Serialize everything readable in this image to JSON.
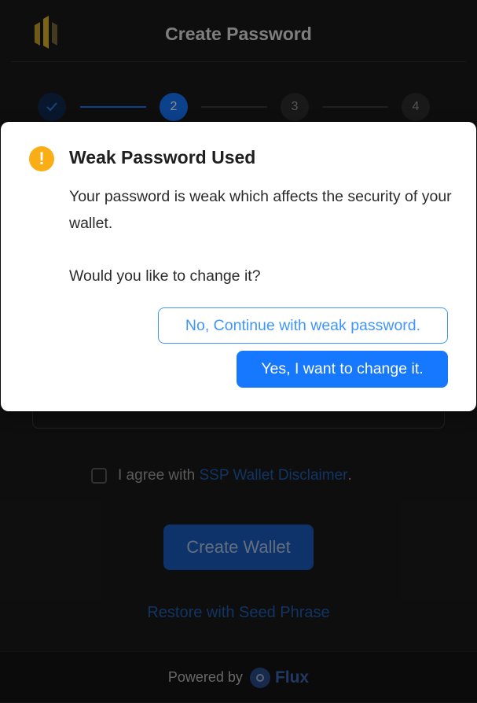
{
  "header": {
    "title": "Create Password",
    "logo_icon": "ssp-logo-icon"
  },
  "stepper": {
    "steps": [
      {
        "label": "",
        "state": "done",
        "icon": "check-icon"
      },
      {
        "label": "2",
        "state": "active"
      },
      {
        "label": "3",
        "state": "todo"
      },
      {
        "label": "4",
        "state": "todo"
      }
    ]
  },
  "form": {
    "agree_prefix": "I agree with ",
    "agree_link": "SSP Wallet Disclaimer",
    "agree_suffix": ".",
    "create_button": "Create Wallet",
    "restore_link": "Restore with Seed Phrase"
  },
  "footer": {
    "powered_by": "Powered by",
    "brand": "Flux",
    "brand_icon": "flux-icon"
  },
  "modal": {
    "icon": "warning-icon",
    "icon_glyph": "!",
    "title": "Weak Password Used",
    "body_line": "Your password is weak which affects the security of your wallet.",
    "question": "Would you like to change it?",
    "cancel_button": "No, Continue with weak password.",
    "confirm_button": "Yes, I want to change it."
  },
  "colors": {
    "primary": "#1677ff",
    "warning": "#faad14",
    "background": "#1b1b1b"
  }
}
